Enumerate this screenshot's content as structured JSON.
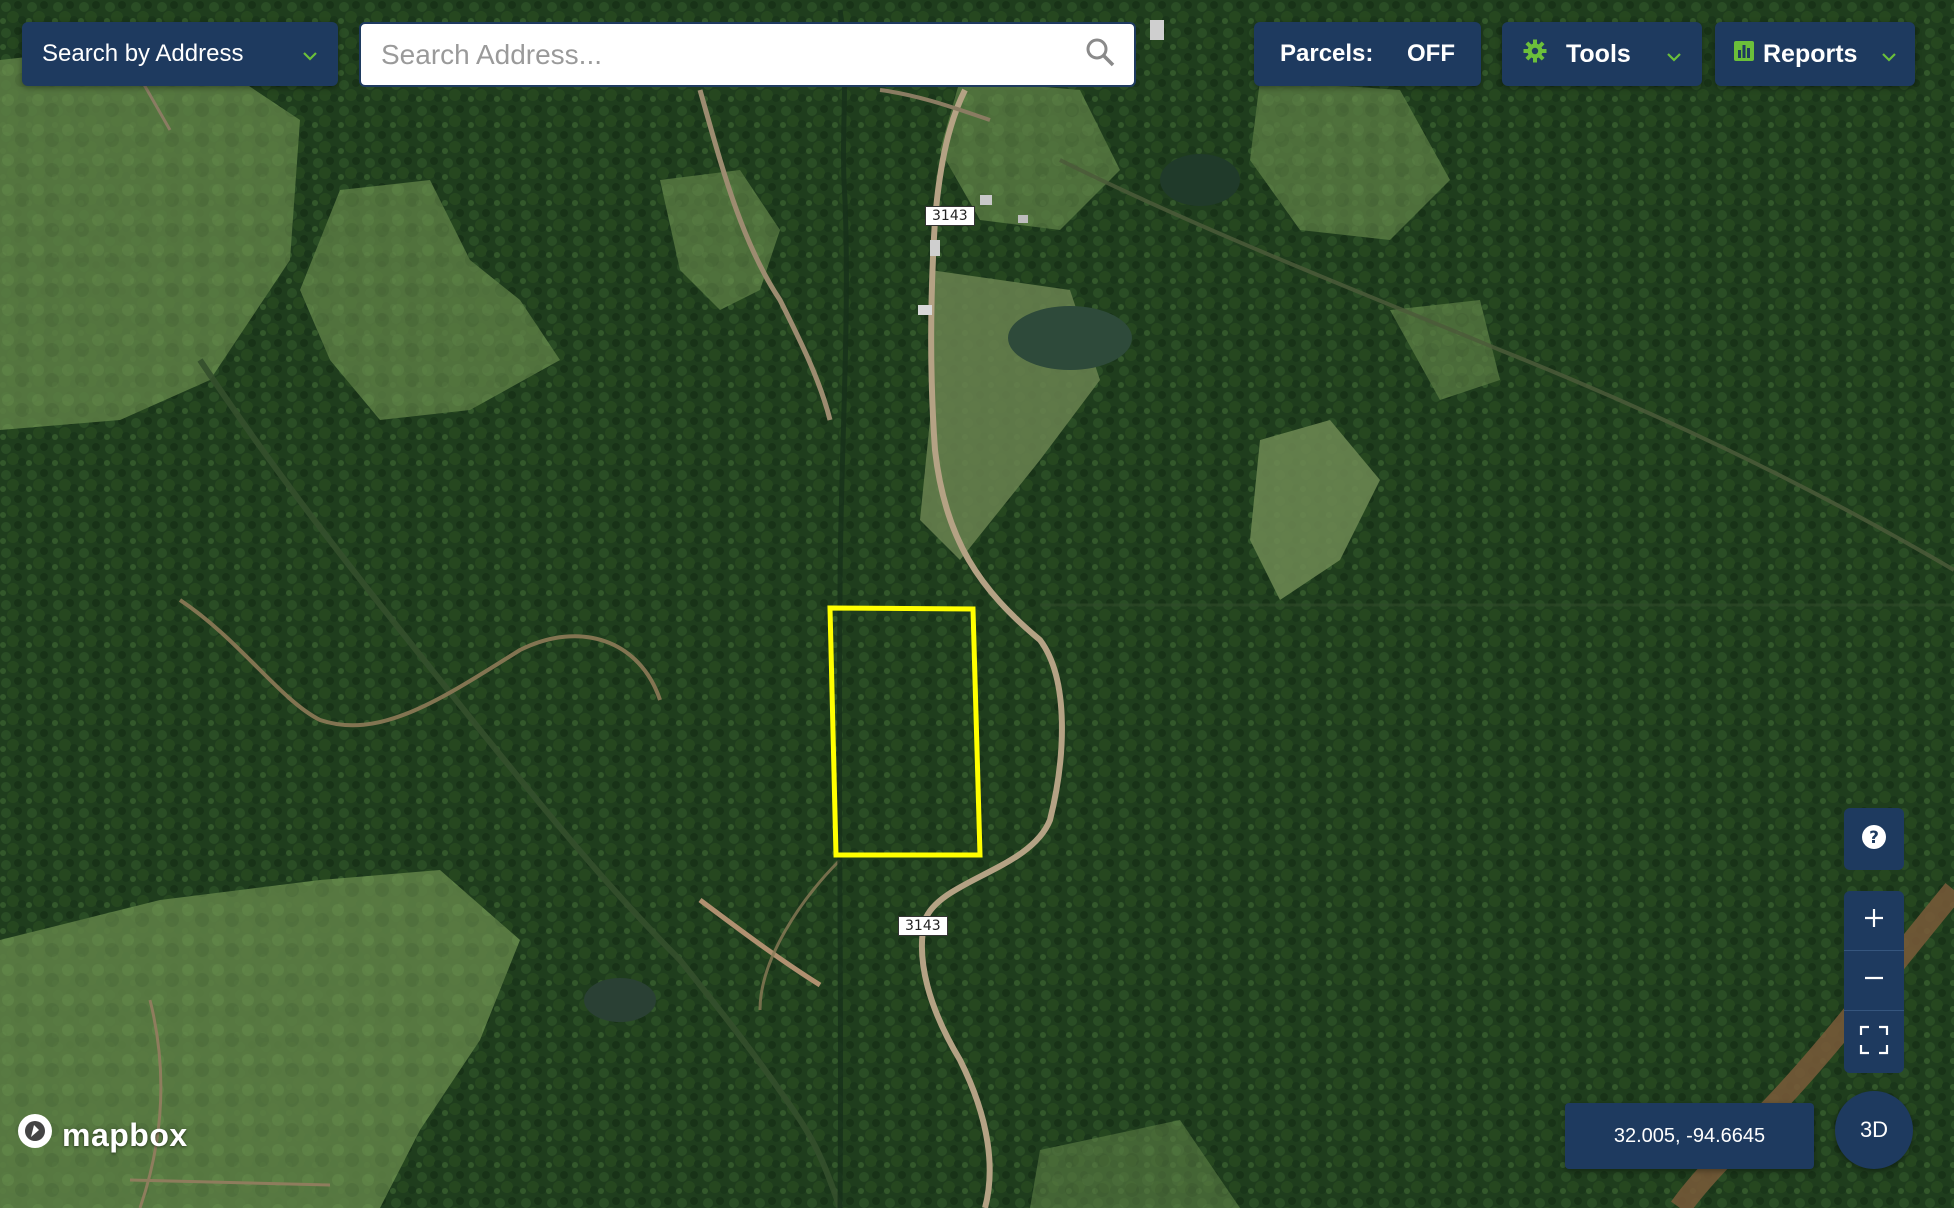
{
  "map": {
    "style": "satellite",
    "parcel_outline_color": "#ffff00",
    "road_shields": [
      "3143",
      "3143"
    ]
  },
  "header": {
    "search_mode_label": "Search by Address",
    "search_placeholder": "Search Address...",
    "search_value": "",
    "parcels_label": "Parcels:",
    "parcels_state": "OFF",
    "tools_label": "Tools",
    "reports_label": "Reports"
  },
  "icons": {
    "search_mode_chevron": "chevron-down-icon",
    "search": "magnifier-icon",
    "tools": "gear-icon",
    "tools_chevron": "chevron-down-icon",
    "reports": "bar-chart-icon",
    "reports_chevron": "chevron-down-icon",
    "help": "question-circle-icon",
    "zoom_in": "plus-icon",
    "zoom_out": "minus-icon",
    "fullscreen": "fullscreen-icon"
  },
  "controls": {
    "coordinates": "32.005, -94.6645",
    "three_d_label": "3D"
  },
  "attribution": {
    "logo_text": "mapbox"
  },
  "colors": {
    "panel_bg": "#1e3a5f",
    "accent_green": "#6bbf3a",
    "text_light": "#ffffff"
  }
}
